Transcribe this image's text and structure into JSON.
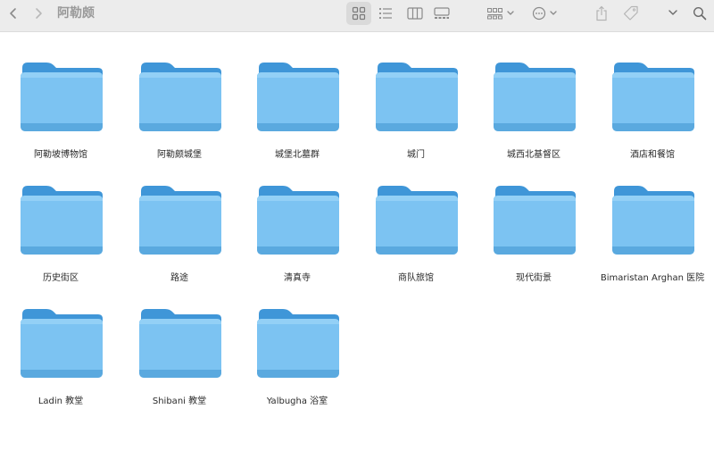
{
  "window": {
    "title": "阿勒颇"
  },
  "toolbar": {
    "back_icon": "chevron-left-icon",
    "forward_icon": "chevron-right-icon",
    "view_icon_grid": "icon-view-icon",
    "view_list": "list-view-icon",
    "view_columns": "column-view-icon",
    "view_gallery": "gallery-view-icon",
    "group": "group-icon",
    "action": "ellipsis-circle-icon",
    "share": "share-icon",
    "tag": "tag-icon",
    "more": "chevron-double-right-icon",
    "search": "search-icon"
  },
  "colors": {
    "toolbar_bg": "#ececec",
    "folder_front": "#7cc3f2",
    "folder_back": "#3f96d8",
    "title_text": "#9a9a9a"
  },
  "folders": [
    {
      "label": "阿勒坡博物馆"
    },
    {
      "label": "阿勒颇城堡"
    },
    {
      "label": "城堡北墓群"
    },
    {
      "label": "城门"
    },
    {
      "label": "城西北基督区"
    },
    {
      "label": "酒店和餐馆"
    },
    {
      "label": "历史街区"
    },
    {
      "label": "路途"
    },
    {
      "label": "清真寺"
    },
    {
      "label": "商队旅馆"
    },
    {
      "label": "现代街景"
    },
    {
      "label": "Bimaristan Arghan 医院"
    },
    {
      "label": "Ladin 教堂"
    },
    {
      "label": "Shibani 教堂"
    },
    {
      "label": "Yalbugha 浴室"
    }
  ]
}
